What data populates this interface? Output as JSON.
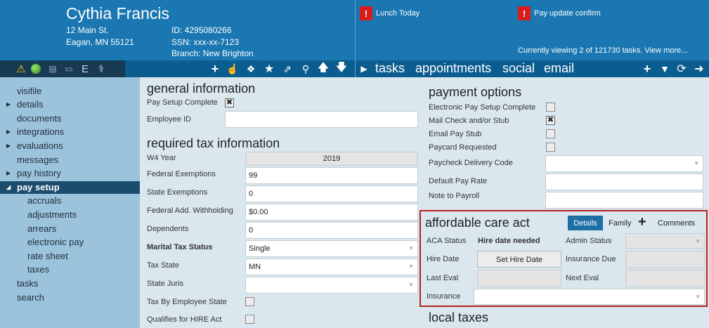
{
  "header": {
    "name": "Cythia Francis",
    "address_line1": "12 Main St.",
    "address_line2": "Eagan, MN 55121",
    "id_line": "ID: 4295080266",
    "ssn_line": "SSN:  xxx-xx-7123",
    "branch_line": "Branch:  New Brighton",
    "alerts": [
      "Lunch Today",
      "Pay update confirm"
    ],
    "alert_mark": "!",
    "viewing_text": "Currently viewing 2 of 121730 tasks. View more..."
  },
  "toolbar": {
    "status_icons": [
      "warning-icon",
      "green-status-icon",
      "clipboard-icon",
      "id-card-icon",
      "e-icon",
      "caduceus-icon"
    ],
    "e_label": "E",
    "action_icons": [
      "plus-icon",
      "pointer-icon",
      "puzzle-icon",
      "star-icon",
      "external-link-icon",
      "search-icon",
      "arrow-up-icon",
      "arrow-down-icon"
    ],
    "tabs": [
      "tasks",
      "appointments",
      "social",
      "email"
    ],
    "right_icons": [
      "plus-icon",
      "filter-icon",
      "refresh-icon",
      "arrow-right-icon"
    ]
  },
  "sidebar": {
    "items": [
      {
        "label": "visifile",
        "caret": false,
        "sub": false,
        "active": false
      },
      {
        "label": "details",
        "caret": true,
        "sub": false,
        "active": false
      },
      {
        "label": "documents",
        "caret": false,
        "sub": false,
        "active": false
      },
      {
        "label": "integrations",
        "caret": true,
        "sub": false,
        "active": false
      },
      {
        "label": "evaluations",
        "caret": true,
        "sub": false,
        "active": false
      },
      {
        "label": "messages",
        "caret": false,
        "sub": false,
        "active": false
      },
      {
        "label": "pay history",
        "caret": true,
        "sub": false,
        "active": false
      },
      {
        "label": "pay setup",
        "caret": true,
        "sub": false,
        "active": true
      },
      {
        "label": "accruals",
        "caret": false,
        "sub": true,
        "active": false
      },
      {
        "label": "adjustments",
        "caret": false,
        "sub": true,
        "active": false
      },
      {
        "label": "arrears",
        "caret": false,
        "sub": true,
        "active": false
      },
      {
        "label": "electronic pay",
        "caret": false,
        "sub": true,
        "active": false
      },
      {
        "label": "rate sheet",
        "caret": false,
        "sub": true,
        "active": false
      },
      {
        "label": "taxes",
        "caret": false,
        "sub": true,
        "active": false
      },
      {
        "label": "tasks",
        "caret": false,
        "sub": false,
        "active": false
      },
      {
        "label": "search",
        "caret": false,
        "sub": false,
        "active": false
      }
    ]
  },
  "general": {
    "title": "general information",
    "pay_setup_complete_label": "Pay Setup Complete",
    "pay_setup_complete_checked": true,
    "employee_id_label": "Employee ID",
    "employee_id_value": ""
  },
  "tax": {
    "title": "required tax information",
    "w4_year_label": "W4 Year",
    "w4_year_value": "2019",
    "federal_exemptions_label": "Federal Exemptions",
    "federal_exemptions_value": "99",
    "state_exemptions_label": "State Exemptions",
    "state_exemptions_value": "0",
    "federal_add_withholding_label": "Federal Add. Withholding",
    "federal_add_withholding_value": "$0.00",
    "dependents_label": "Dependents",
    "dependents_value": "0",
    "marital_status_label": "Marital Tax Status",
    "marital_status_value": "Single",
    "tax_state_label": "Tax State",
    "tax_state_value": "MN",
    "state_juris_label": "State Juris",
    "state_juris_value": "",
    "tax_by_employee_state_label": "Tax By Employee State",
    "tax_by_employee_state_checked": false,
    "qualifies_hire_act_label": "Qualifies for HIRE Act",
    "qualifies_hire_act_checked": false
  },
  "payment": {
    "title": "payment options",
    "electronic_pay_setup_label": "Electronic Pay Setup Complete",
    "electronic_pay_setup_checked": false,
    "mail_check_label": "Mail Check and/or Stub",
    "mail_check_checked": true,
    "email_pay_stub_label": "Email Pay Stub",
    "email_pay_stub_checked": false,
    "paycard_requested_label": "Paycard Requested",
    "paycard_requested_checked": false,
    "paycheck_delivery_label": "Paycheck Delivery Code",
    "paycheck_delivery_value": "",
    "default_pay_rate_label": "Default Pay Rate",
    "default_pay_rate_value": "",
    "note_to_payroll_label": "Note to Payroll",
    "note_to_payroll_value": ""
  },
  "aca": {
    "title": "affordable care act",
    "tab_details": "Details",
    "tab_family": "Family",
    "tab_comments": "Comments",
    "plus_label": "+",
    "aca_status_label": "ACA Status",
    "aca_status_value": "Hire date needed",
    "admin_status_label": "Admin Status",
    "hire_date_label": "Hire Date",
    "set_hire_date_label": "Set Hire Date",
    "insurance_due_label": "Insurance Due",
    "last_eval_label": "Last Eval",
    "next_eval_label": "Next Eval",
    "insurance_label": "Insurance"
  },
  "local_taxes": {
    "title": "local taxes"
  },
  "colors": {
    "header_blue": "#1a77b1",
    "toolbar_blue": "#0c5d8f",
    "sidebar_blue": "#9cc3dc",
    "active_nav": "#1b4c6e",
    "content_bg": "#dae7ef",
    "alert_red": "#d91d1d",
    "aca_border": "#b51f1f",
    "details_tab": "#1c6ea4"
  }
}
